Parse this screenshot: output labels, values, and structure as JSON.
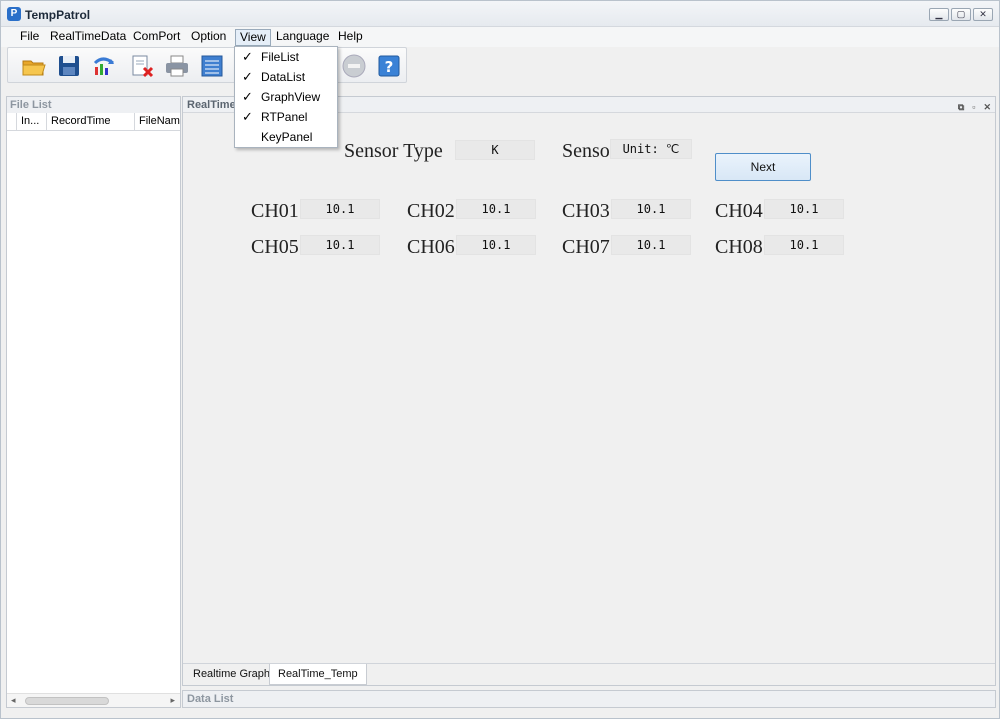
{
  "window": {
    "title": "TempPatrol",
    "app_icon_glyph": "P",
    "controls": [
      "▁",
      "▢",
      "✕"
    ]
  },
  "menubar": {
    "items": [
      "File",
      "RealTimeData",
      "ComPort",
      "Option",
      "View",
      "Language",
      "Help"
    ],
    "active": "View"
  },
  "toolbar": {
    "buttons": [
      {
        "icon": "open-folder-icon"
      },
      {
        "icon": "save-icon"
      },
      {
        "icon": "refresh-chart-icon"
      },
      {
        "icon": "delete-file-icon"
      },
      {
        "icon": "print-icon"
      },
      {
        "icon": "list-view-icon"
      },
      {
        "icon": "stop-icon"
      },
      {
        "icon": "help-icon"
      }
    ]
  },
  "view_menu": {
    "items": [
      {
        "label": "FileList",
        "checked": "✓"
      },
      {
        "label": "DataList",
        "checked": "✓"
      },
      {
        "label": "GraphView",
        "checked": "✓"
      },
      {
        "label": "RTPanel",
        "checked": "✓"
      },
      {
        "label": "KeyPanel",
        "checked": ""
      }
    ]
  },
  "file_list": {
    "title": "File List",
    "columns": [
      "In...",
      "RecordTime",
      "FileName"
    ]
  },
  "realtime_panel": {
    "title": "RealTime",
    "controls": [
      "⧉",
      "▫",
      "✕"
    ],
    "sensor_type_label": "Sensor Type",
    "sensor_type_value": "K",
    "sensor_unit_label": "Senso",
    "unit_value": "Unit: ℃",
    "next_button": "Next",
    "channels": [
      {
        "label": "CH01",
        "value": "10.1"
      },
      {
        "label": "CH02",
        "value": "10.1"
      },
      {
        "label": "CH03",
        "value": "10.1"
      },
      {
        "label": "CH04",
        "value": "10.1"
      },
      {
        "label": "CH05",
        "value": "10.1"
      },
      {
        "label": "CH06",
        "value": "10.1"
      },
      {
        "label": "CH07",
        "value": "10.1"
      },
      {
        "label": "CH08",
        "value": "10.1"
      }
    ],
    "tabs": [
      "Realtime Graph",
      "RealTime_Temp"
    ],
    "active_tab": "RealTime_Temp"
  },
  "data_list": {
    "title": "Data List"
  },
  "colors": {
    "accent": "#2a6fc9",
    "button_border": "#4f8ec9"
  }
}
